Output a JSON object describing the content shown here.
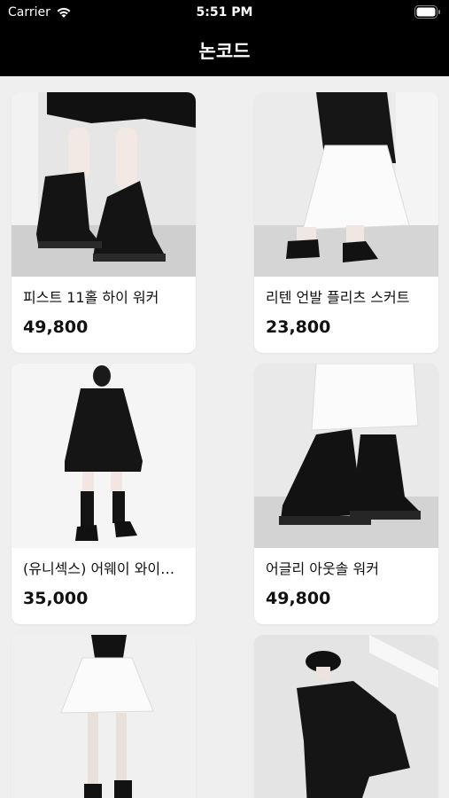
{
  "status_bar": {
    "carrier": "Carrier",
    "time": "5:51 PM"
  },
  "nav": {
    "title": "논코드"
  },
  "products": [
    {
      "name": "피스트 11홀 하이 워커",
      "price": "49,800",
      "image": "black-lace-up-boots"
    },
    {
      "name": "리텐 언발 플리츠 스커트",
      "price": "23,800",
      "image": "white-pleated-skirt"
    },
    {
      "name": "(유니섹스) 어웨이 와이…",
      "price": "35,000",
      "image": "black-shirt-dress"
    },
    {
      "name": "어글리 아웃솔 워커",
      "price": "49,800",
      "image": "black-chunky-boots"
    },
    {
      "name": "",
      "price": "",
      "image": "white-mini-skirt"
    },
    {
      "name": "",
      "price": "",
      "image": "black-outfit-cap"
    }
  ]
}
